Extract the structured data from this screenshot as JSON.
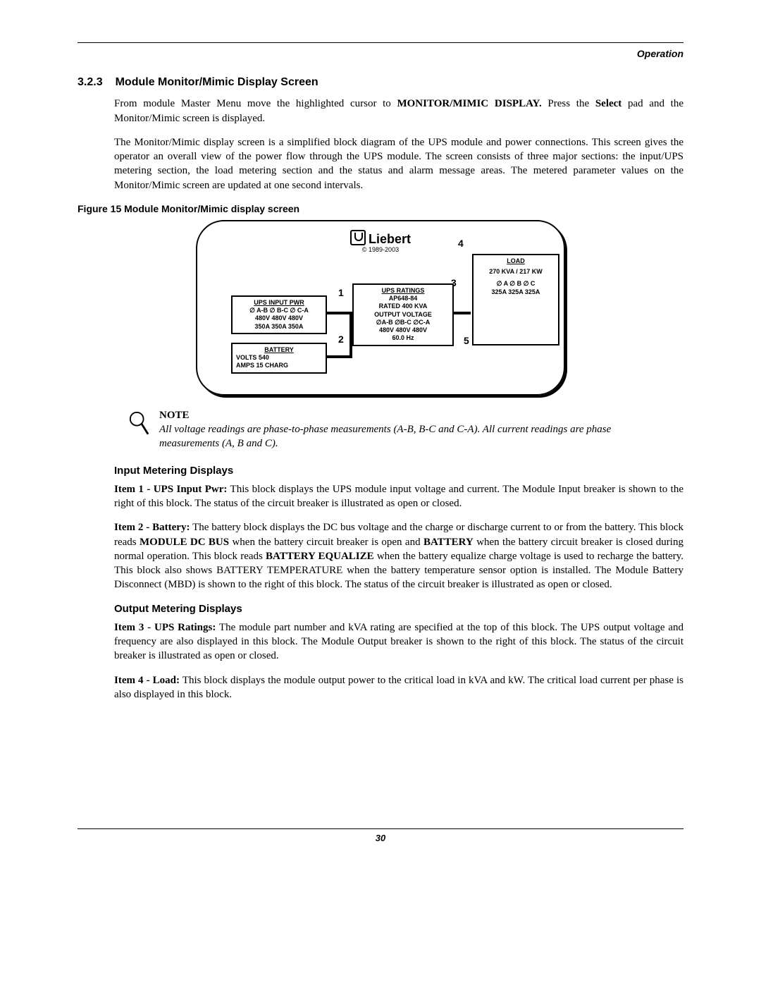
{
  "header": {
    "section_label": "Operation"
  },
  "section": {
    "number": "3.2.3",
    "title": "Module Monitor/Mimic Display Screen",
    "para1_a": "From module Master Menu move the highlighted cursor to ",
    "para1_b": "MONITOR/MIMIC DISPLAY.",
    "para1_c": " Press the ",
    "para1_d": "Select",
    "para1_e": " pad and the Monitor/Mimic screen is displayed.",
    "para2": "The Monitor/Mimic display screen is a simplified block diagram of the UPS module and power connections. This screen gives the operator an overall view of the power flow through the UPS module. The screen consists of three major sections: the input/UPS metering section, the load metering section and the status and alarm message areas. The metered parameter values on the Monitor/Mimic screen are updated at one second intervals."
  },
  "figure": {
    "caption": "Figure 15  Module Monitor/Mimic display screen",
    "brand": "Liebert",
    "copyright": "© 1989-2003",
    "callouts": {
      "c1": "1",
      "c2": "2",
      "c3": "3",
      "c4": "4",
      "c5": "5"
    },
    "input": {
      "title": "UPS INPUT PWR",
      "phases": "∅ A-B  ∅ B-C  ∅ C-A",
      "volts": "480V   480V   480V",
      "amps": "350A   350A   350A"
    },
    "ratings": {
      "title": "UPS RATINGS",
      "model": "AP648-84",
      "rated": "RATED 400 KVA",
      "out_title": "OUTPUT VOLTAGE",
      "phases": "∅A-B  ∅B-C  ∅C-A",
      "volts": "480V   480V   480V",
      "freq": "60.0 Hz"
    },
    "load": {
      "title": "LOAD",
      "power": "270 KVA / 217 KW",
      "phases": "∅ A     ∅ B     ∅ C",
      "amps": "325A  325A  325A"
    },
    "battery": {
      "title": "BATTERY",
      "volts": "VOLTS 540",
      "amps": "AMPS 15 CHARG"
    }
  },
  "note": {
    "title": "NOTE",
    "text": "All voltage readings are phase-to-phase measurements (A-B, B-C and C-A). All current readings are phase measurements (A, B and C)."
  },
  "input_metering": {
    "heading": "Input Metering Displays",
    "item1_lead": "Item 1 - UPS Input Pwr:",
    "item1_body": " This block displays the UPS module input voltage and current. The Module Input breaker is shown to the right of this block. The status of the circuit breaker is illustrated as open or closed.",
    "item2_lead": "Item 2 - Battery:",
    "item2_a": " The battery block displays the DC bus voltage and the charge or discharge current to or from the battery. This block reads ",
    "item2_b": "MODULE DC BUS",
    "item2_c": " when the battery circuit breaker is open and ",
    "item2_d": "BATTERY",
    "item2_e": " when the battery circuit breaker is closed during normal operation. This block reads ",
    "item2_f": "BATTERY EQUALIZE",
    "item2_g": " when the battery equalize charge voltage is used to recharge the battery. This block also shows BATTERY TEMPERATURE when the battery temperature sensor option is installed. The Module Battery Disconnect (MBD) is shown to the right of this block. The status of the circuit breaker is illustrated as open or closed."
  },
  "output_metering": {
    "heading": "Output Metering Displays",
    "item3_lead": "Item 3 - UPS Ratings:",
    "item3_body": " The module part number and kVA rating are specified at the top of this block. The UPS output voltage and frequency are also displayed in this block. The Module Output breaker is shown to the right of this block. The status of the circuit breaker is illustrated as open or closed.",
    "item4_lead": "Item 4 - Load:",
    "item4_body": " This block displays the module output power to the critical load in kVA and kW. The critical load current per phase is also displayed in this block."
  },
  "footer": {
    "page": "30"
  }
}
